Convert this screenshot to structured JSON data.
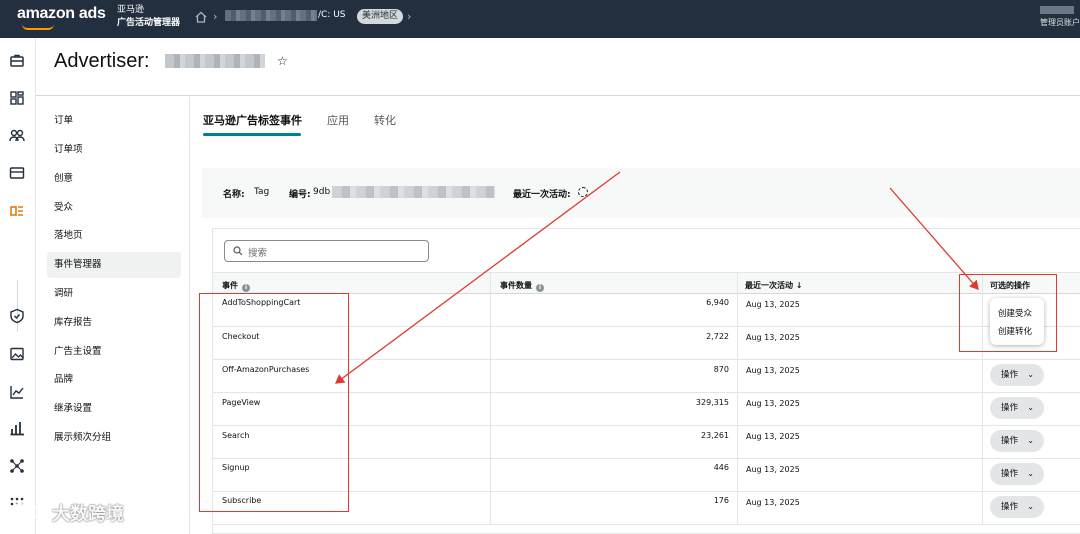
{
  "topbar": {
    "logo": "amazon ads",
    "brand_line1": "亚马逊",
    "brand_line2": "广告活动管理器",
    "crumb_tail": "/C: US",
    "region": "美洲地区",
    "user_role": "管理员账户"
  },
  "header": {
    "title": "Advertiser:"
  },
  "sidenav": {
    "items": [
      "订单",
      "订单项",
      "创意",
      "受众",
      "落地页",
      "事件管理器",
      "调研",
      "库存报告",
      "广告主设置",
      "品牌",
      "继承设置",
      "展示频次分组"
    ],
    "active_index": 5
  },
  "tabs": [
    "亚马逊广告标签事件",
    "应用",
    "转化"
  ],
  "info": {
    "name_label": "名称:",
    "name_value": "Tag",
    "id_label": "编号:",
    "id_prefix": "9db",
    "last_activity_label": "最近一次活动:"
  },
  "search": {
    "placeholder": "搜索"
  },
  "table": {
    "headers": {
      "event": "事件",
      "count": "事件数量",
      "last": "最近一次活动 ↓",
      "actions": "可选的操作"
    },
    "rows": [
      {
        "event": "AddToShoppingCart",
        "count": "6,940",
        "last": "Aug 13, 2025"
      },
      {
        "event": "Checkout",
        "count": "2,722",
        "last": "Aug 13, 2025"
      },
      {
        "event": "Off-AmazonPurchases",
        "count": "870",
        "last": "Aug 13, 2025"
      },
      {
        "event": "PageView",
        "count": "329,315",
        "last": "Aug 13, 2025"
      },
      {
        "event": "Search",
        "count": "23,261",
        "last": "Aug 13, 2025"
      },
      {
        "event": "Signup",
        "count": "446",
        "last": "Aug 13, 2025"
      },
      {
        "event": "Subscribe",
        "count": "176",
        "last": "Aug 13, 2025"
      }
    ],
    "action_label": "操作"
  },
  "dropdown": {
    "items": [
      "创建受众",
      "创建转化"
    ]
  },
  "watermark": "大数跨境",
  "colors": {
    "topbar": "#232f3e",
    "accent": "#008296",
    "annotation": "#e03a2e",
    "logo_smile": "#ff9900"
  }
}
